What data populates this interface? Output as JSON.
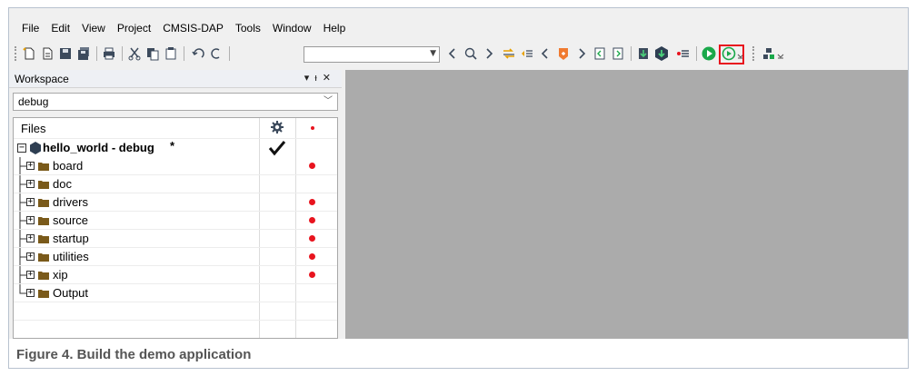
{
  "menu": {
    "items": [
      "File",
      "Edit",
      "View",
      "Project",
      "CMSIS-DAP",
      "Tools",
      "Window",
      "Help"
    ]
  },
  "toolbar": {
    "configuration_value": "",
    "icons": [
      "new-file-icon",
      "open-file-icon",
      "save-icon",
      "save-all-icon",
      "print-icon",
      "cut-icon",
      "copy-icon",
      "paste-icon",
      "undo-icon",
      "redo-icon",
      "find-back-icon",
      "find-icon",
      "find-next-icon",
      "toggle-bookmark-icon",
      "go-to-icon",
      "navigate-back-icon",
      "breakpoint-icon",
      "navigate-forward-icon",
      "prev-bookmark-icon",
      "next-bookmark-icon",
      "compile-icon",
      "make-icon",
      "build-options-icon",
      "download-debug-icon",
      "debug-no-download-icon",
      "layout-icon"
    ],
    "highlighted_icon": "make-icon"
  },
  "workspace": {
    "title": "Workspace",
    "configuration": "debug",
    "files_header": "Files",
    "project_name": "hello_world - debug",
    "project_modified_marker": "*",
    "folders": [
      {
        "name": "board",
        "dot": true
      },
      {
        "name": "doc",
        "dot": false
      },
      {
        "name": "drivers",
        "dot": true
      },
      {
        "name": "source",
        "dot": true
      },
      {
        "name": "startup",
        "dot": true
      },
      {
        "name": "utilities",
        "dot": true
      },
      {
        "name": "xip",
        "dot": true
      },
      {
        "name": "Output",
        "dot": false
      }
    ]
  },
  "caption": "Figure 4.  Build the demo application",
  "colors": {
    "highlight": "#e8141e",
    "editor_bg": "#ababab",
    "folder": "#7a5a1a",
    "run_green": "#1aa84a"
  }
}
